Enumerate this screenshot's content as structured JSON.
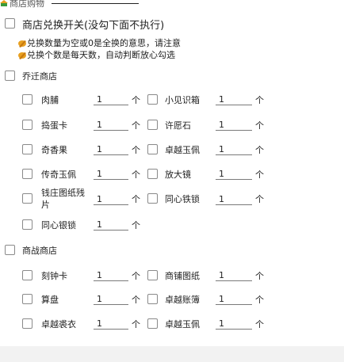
{
  "header": {
    "title": "商店购物",
    "line_color": "#222222"
  },
  "master": {
    "label": "商店兑换开关(没勾下面不执行)"
  },
  "notes": [
    "兑换数量为空或0是全换的意思，请注意",
    "兑换个数是每天数，自动判断放心勾选"
  ],
  "shop1": {
    "label": "乔迁商店",
    "items": [
      {
        "name": "肉脯",
        "qty": "1",
        "unit": "个"
      },
      {
        "name": "小见识箱",
        "qty": "1",
        "unit": "个"
      },
      {
        "name": "捣蛋卡",
        "qty": "1",
        "unit": "个"
      },
      {
        "name": "许愿石",
        "qty": "1",
        "unit": "个"
      },
      {
        "name": "奇香果",
        "qty": "1",
        "unit": "个"
      },
      {
        "name": "卓越玉佩",
        "qty": "1",
        "unit": "个"
      },
      {
        "name": "传奇玉佩",
        "qty": "1",
        "unit": "个"
      },
      {
        "name": "放大镜",
        "qty": "1",
        "unit": "个"
      },
      {
        "name": "钱庄图纸残片",
        "qty": "1",
        "unit": "个"
      },
      {
        "name": "同心铁锁",
        "qty": "1",
        "unit": "个"
      },
      {
        "name": "同心银锁",
        "qty": "1",
        "unit": "个"
      }
    ]
  },
  "shop2": {
    "label": "商战商店",
    "items": [
      {
        "name": "刻钟卡",
        "qty": "1",
        "unit": "个"
      },
      {
        "name": "商铺图纸",
        "qty": "1",
        "unit": "个"
      },
      {
        "name": "算盘",
        "qty": "1",
        "unit": "个"
      },
      {
        "name": "卓越账簿",
        "qty": "1",
        "unit": "个"
      },
      {
        "name": "卓越裘衣",
        "qty": "1",
        "unit": "个"
      },
      {
        "name": "卓越玉佩",
        "qty": "1",
        "unit": "个"
      }
    ]
  },
  "icons": {
    "header_icon": "shop-bag-icon",
    "note_icon": "pencil-note-icon"
  },
  "colors": {
    "note_icon": "#e8a020",
    "header_icon_green": "#3a9a3a",
    "header_icon_orange": "#e8a020"
  }
}
